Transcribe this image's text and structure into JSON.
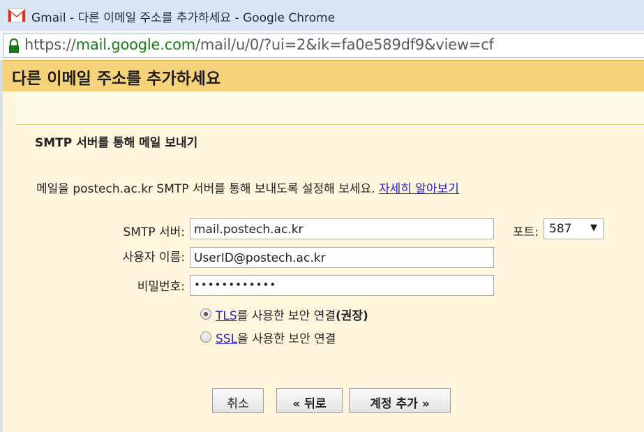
{
  "window": {
    "title": "Gmail - 다른 이메일 주소를 추가하세요 - Google Chrome"
  },
  "address_bar": {
    "scheme": "https://",
    "host": "mail.google.com",
    "path": "/mail/u/0/?ui=2&ik=fa0e589df9&view=cf"
  },
  "dialog": {
    "title": "다른 이메일 주소를 추가하세요",
    "subtitle": "SMTP 서버를 통해 메일 보내기",
    "description": "메일을 postech.ac.kr SMTP 서버를 통해 보내도록 설정해 보세요.",
    "learn_more": "자세히 알아보기",
    "smtp_label": "SMTP 서버:",
    "smtp_value": "mail.postech.ac.kr",
    "port_label": "포트:",
    "port_value": "587",
    "username_label": "사용자 이름:",
    "username_value": "UserID@postech.ac.kr",
    "password_label": "비밀번호:",
    "password_value": "••••••••••••",
    "tls_link": "TLS",
    "tls_text": "를 사용한 보안 연결",
    "tls_recommended": "(권장)",
    "ssl_link": "SSL",
    "ssl_text": "을 사용한 보안 연결",
    "cancel_button": "취소",
    "back_button": "« 뒤로",
    "add_account_button": "계정 추가 »"
  },
  "colors": {
    "header_bg": "#f6d27a",
    "panel_bg": "#fff6dd",
    "link": "#2222cc"
  }
}
